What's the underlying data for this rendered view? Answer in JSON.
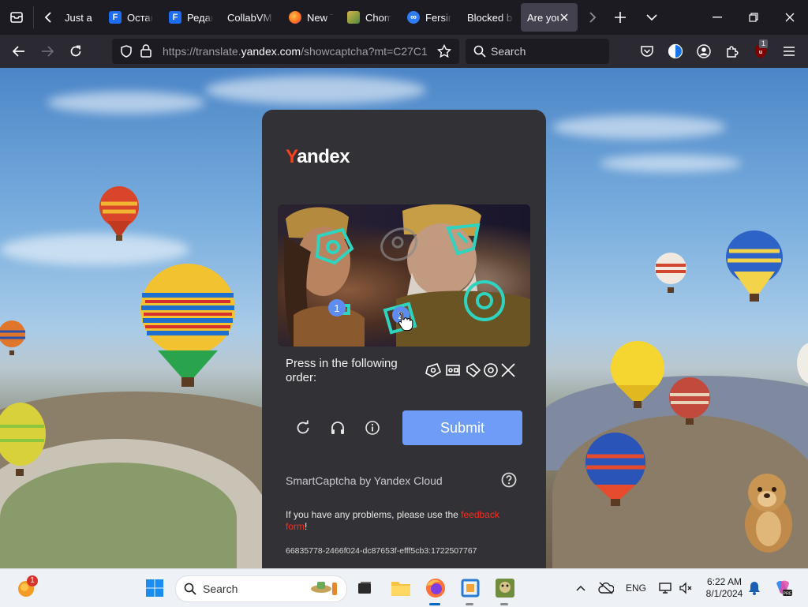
{
  "browser": {
    "tabs": [
      {
        "label": "Just a",
        "icon": "globe-icon"
      },
      {
        "label": "Остан",
        "icon": "doc-icon"
      },
      {
        "label": "Редак",
        "icon": "doc-icon"
      },
      {
        "label": "CollabVM",
        "icon": "none"
      },
      {
        "label": "New T",
        "icon": "firefox-icon"
      },
      {
        "label": "Chom",
        "icon": "game-icon"
      },
      {
        "label": "Fersin",
        "icon": "link-icon"
      },
      {
        "label": "Blocked b",
        "icon": "none"
      },
      {
        "label": "Are you",
        "icon": "none",
        "active": true
      }
    ],
    "url": {
      "prefix": "https://translate.",
      "domain": "yandex.com",
      "suffix": "/showcaptcha?mt=C27C1"
    },
    "search_placeholder": "Search",
    "extension_badge": "1"
  },
  "captcha": {
    "logo_first": "Y",
    "logo_rest": "andex",
    "order_label": "Press in the following order:",
    "markers": [
      "1",
      "2"
    ],
    "submit_label": "Submit",
    "brand": "SmartCaptcha by Yandex Cloud",
    "problems_text": "If you have any problems, please use the ",
    "feedback_link": "feedback form",
    "problems_end": "!",
    "token": "66835778-2466f024-dc87653f-efff5cb3:1722507767"
  },
  "taskbar": {
    "notification_badge": "1",
    "search_placeholder": "Search",
    "language": "ENG",
    "time": "6:22 AM",
    "date": "8/1/2024"
  },
  "colors": {
    "yandex_red": "#fc3f1d",
    "submit_blue": "#6f9cf6",
    "link_red": "#ff2a1a",
    "card_bg": "#323236"
  }
}
